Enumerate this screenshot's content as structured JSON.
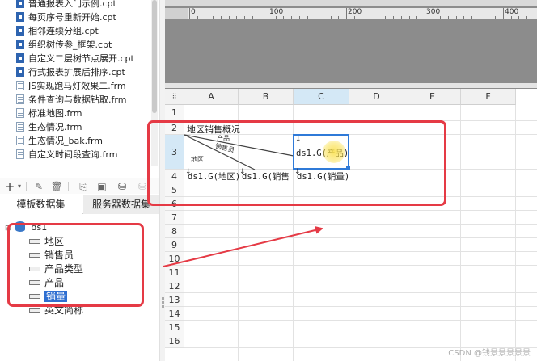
{
  "file_list": [
    {
      "name": "普通报表入门示例.cpt",
      "type": "cpt"
    },
    {
      "name": "每页序号重新开始.cpt",
      "type": "cpt"
    },
    {
      "name": "相邻连续分组.cpt",
      "type": "cpt"
    },
    {
      "name": "组织树传参_框架.cpt",
      "type": "cpt"
    },
    {
      "name": "自定义二层树节点展开.cpt",
      "type": "cpt"
    },
    {
      "name": "行式报表扩展后排序.cpt",
      "type": "cpt"
    },
    {
      "name": "JS实现跑马灯效果二.frm",
      "type": "frm"
    },
    {
      "name": "条件查询与数据钻取.frm",
      "type": "frm"
    },
    {
      "name": "标准地图.frm",
      "type": "frm"
    },
    {
      "name": "生态情况.frm",
      "type": "frm"
    },
    {
      "name": "生态情况_bak.frm",
      "type": "frm"
    },
    {
      "name": "自定义时间段查询.frm",
      "type": "frm"
    }
  ],
  "dataset_toolbar": {
    "icons": [
      "add-icon",
      "dropdown-arrow-icon",
      "edit-icon",
      "delete-icon",
      "preview-icon",
      "copy-icon",
      "database-icon",
      "settings-icon"
    ]
  },
  "dataset_tabs": {
    "template": "模板数据集",
    "server": "服务器数据集"
  },
  "dataset": {
    "name": "ds1",
    "fields": [
      "地区",
      "销售员",
      "产品类型",
      "产品",
      "销量",
      "英文简称"
    ],
    "selected_field": "销量"
  },
  "ruler": {
    "labels": [
      "0",
      "100",
      "200",
      "300",
      "400"
    ]
  },
  "sheet": {
    "columns": [
      "A",
      "B",
      "C",
      "D",
      "E",
      "F"
    ],
    "active_column": "C",
    "rows": [
      "1",
      "2",
      "3",
      "4",
      "5",
      "6",
      "7",
      "8",
      "9",
      "10",
      "11",
      "12",
      "13",
      "14",
      "15",
      "16"
    ],
    "active_row": "3",
    "title_cell": "地区销售概况",
    "diagonal_labels": {
      "top": "产品",
      "middle": "销售员",
      "bottom": "地区"
    },
    "c3": "ds1.G(产品)",
    "a4": "ds1.G(地区)",
    "b4": "ds1.G(销售",
    "c4": "ds1.G(销量)"
  },
  "watermark": "CSDN @钱景景景景景",
  "colors": {
    "annotation_red": "#e53a45",
    "selection_blue": "#2f7ad8",
    "dataset_blue": "#3a78c8"
  }
}
